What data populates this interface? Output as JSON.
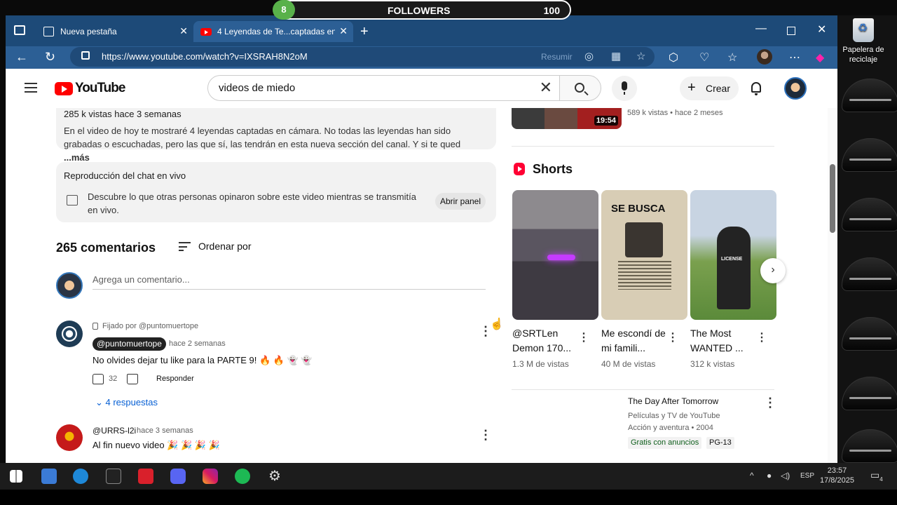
{
  "desktop": {
    "recycle_bin_label": "Papelera de reciclaje"
  },
  "overlay": {
    "badge": "8",
    "followers_label": "FOLLOWERS",
    "followers_count": "100"
  },
  "browser": {
    "tabs": [
      {
        "label": "Nueva pestaña",
        "icon": "tab-icon"
      },
      {
        "label": "4 Leyendas de Te...captadas en",
        "icon": "youtube-icon"
      }
    ],
    "url": "https://www.youtube.com/watch?v=IXSRAH8N2oM",
    "resumir": "Resumir",
    "colors": {
      "tabbar": "#1d4a78",
      "navbar": "#2c5f95",
      "active_tab": "#2c5f95"
    }
  },
  "youtube": {
    "logo": "YouTube",
    "search_value": "videos de miedo",
    "create_label": "Crear",
    "description": {
      "meta": "285 k vistas  hace 3 semanas",
      "text": "En el video de hoy te mostraré 4 leyendas captadas en cámara. No todas las leyendas han sido grabadas o escuchadas, pero las que sí, las tendrán en esta nueva sección del canal. Y si te qued",
      "more": "...más"
    },
    "chat": {
      "title": "Reproducción del chat en vivo",
      "text": "Descubre lo que otras personas opinaron sobre este video mientras se transmitía en vivo.",
      "button": "Abrir panel"
    },
    "comments_count": "265 comentarios",
    "sort_label": "Ordenar por",
    "add_comment_placeholder": "Agrega un comentario...",
    "comments": [
      {
        "pinned": "Fijado por @puntomuertope",
        "author": "@puntomuertope",
        "time": "hace 2 semanas",
        "text": "No olvides dejar tu like para la PARTE 9! 🔥 🔥 👻 👻",
        "likes": "32",
        "reply": "Responder",
        "replies": "4 respuestas"
      },
      {
        "author": "@URRS-l2i",
        "time": "hace 3 semanas",
        "text": "Al fin nuevo video 🎉 🎉 🎉 🎉"
      }
    ],
    "prev_video": {
      "duration": "19:54",
      "meta": "589 k vistas • hace 2 meses"
    },
    "shorts_title": "Shorts",
    "shorts": [
      {
        "title": "@SRTLen Demon 170...",
        "views": "1.3 M de vistas"
      },
      {
        "title": "Me escondí de mi famili...",
        "views": "40 M de vistas",
        "poster": "SE BUSCA"
      },
      {
        "title": "The Most WANTED ...",
        "views": "312 k vistas",
        "sign": "LICENSE"
      }
    ],
    "movie": {
      "title": "The Day After Tomorrow",
      "source": "Películas y TV de YouTube",
      "genre": "Acción y aventura • 2004",
      "badge_free": "Gratis con anuncios",
      "rating": "PG-13"
    }
  },
  "taskbar": {
    "lang": "ESP",
    "time": "23:57",
    "date": "17/8/2025",
    "notifications": "4"
  }
}
